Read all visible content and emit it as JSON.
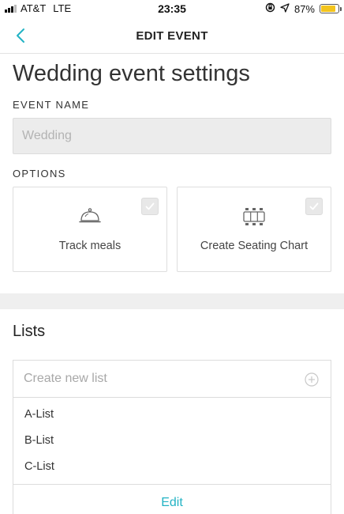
{
  "status_bar": {
    "carrier": "AT&T",
    "network": "LTE",
    "time": "23:35",
    "battery_percent": "87%",
    "battery_level": 0.87,
    "battery_color": "#f3c41d",
    "icons": [
      "signal-bars-icon",
      "lock-rotation-icon",
      "location-arrow-icon",
      "battery-icon"
    ]
  },
  "nav": {
    "title": "EDIT EVENT",
    "back_icon": "chevron-left-icon",
    "accent_color": "#23b3c4"
  },
  "page": {
    "title": "Wedding event settings"
  },
  "event_name": {
    "label": "EVENT NAME",
    "placeholder": "Wedding",
    "value": ""
  },
  "options": {
    "label": "OPTIONS",
    "items": [
      {
        "label": "Track meals",
        "icon": "cloche-icon",
        "checked": false
      },
      {
        "label": "Create Seating Chart",
        "icon": "seating-table-icon",
        "checked": false
      }
    ]
  },
  "lists": {
    "title": "Lists",
    "new_list_placeholder": "Create new list",
    "add_icon": "plus-circle-icon",
    "items": [
      "A-List",
      "B-List",
      "C-List"
    ],
    "edit_label": "Edit"
  }
}
